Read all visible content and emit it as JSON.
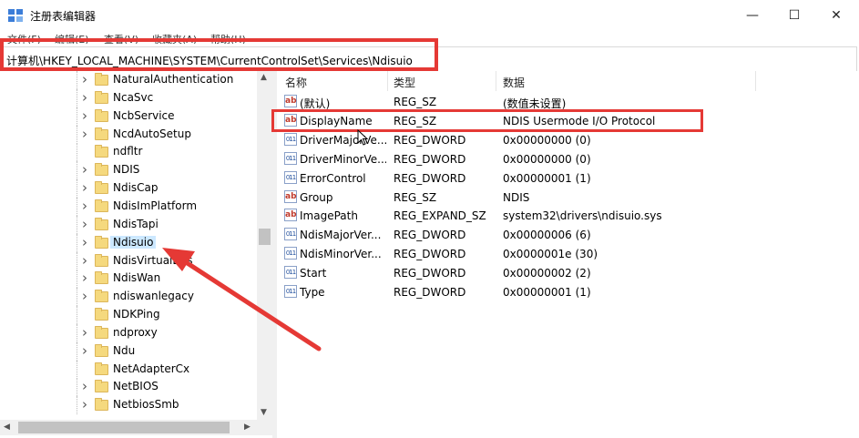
{
  "window": {
    "title": "注册表编辑器",
    "minimize": "—",
    "maximize": "☐",
    "close": "✕"
  },
  "menu": [
    "文件(F)",
    "编辑(E)",
    "查看(V)",
    "收藏夹(A)",
    "帮助(H)"
  ],
  "address": "计算机\\HKEY_LOCAL_MACHINE\\SYSTEM\\CurrentControlSet\\Services\\Ndisuio",
  "tree": {
    "items": [
      {
        "label": "NaturalAuthentication",
        "expandable": true
      },
      {
        "label": "NcaSvc",
        "expandable": true
      },
      {
        "label": "NcbService",
        "expandable": true
      },
      {
        "label": "NcdAutoSetup",
        "expandable": true
      },
      {
        "label": "ndfltr",
        "expandable": false
      },
      {
        "label": "NDIS",
        "expandable": true
      },
      {
        "label": "NdisCap",
        "expandable": true
      },
      {
        "label": "NdisImPlatform",
        "expandable": true
      },
      {
        "label": "NdisTapi",
        "expandable": true
      },
      {
        "label": "Ndisuio",
        "expandable": true,
        "selected": true
      },
      {
        "label": "NdisVirtualBus",
        "expandable": true
      },
      {
        "label": "NdisWan",
        "expandable": true
      },
      {
        "label": "ndiswanlegacy",
        "expandable": true
      },
      {
        "label": "NDKPing",
        "expandable": false
      },
      {
        "label": "ndproxy",
        "expandable": true
      },
      {
        "label": "Ndu",
        "expandable": true
      },
      {
        "label": "NetAdapterCx",
        "expandable": false
      },
      {
        "label": "NetBIOS",
        "expandable": true
      },
      {
        "label": "NetbiosSmb",
        "expandable": true
      }
    ]
  },
  "list": {
    "headers": {
      "name": "名称",
      "type": "类型",
      "data": "数据"
    },
    "rows": [
      {
        "icon": "string-value-icon",
        "name": "(默认)",
        "type": "REG_SZ",
        "data": "(数值未设置)"
      },
      {
        "icon": "string-value-icon",
        "name": "DisplayName",
        "type": "REG_SZ",
        "data": "NDIS Usermode I/O Protocol"
      },
      {
        "icon": "binary-value-icon",
        "name": "DriverMajorVe...",
        "type": "REG_DWORD",
        "data": "0x00000000 (0)"
      },
      {
        "icon": "binary-value-icon",
        "name": "DriverMinorVe...",
        "type": "REG_DWORD",
        "data": "0x00000000 (0)"
      },
      {
        "icon": "binary-value-icon",
        "name": "ErrorControl",
        "type": "REG_DWORD",
        "data": "0x00000001 (1)"
      },
      {
        "icon": "string-value-icon",
        "name": "Group",
        "type": "REG_SZ",
        "data": "NDIS"
      },
      {
        "icon": "string-value-icon",
        "name": "ImagePath",
        "type": "REG_EXPAND_SZ",
        "data": "system32\\drivers\\ndisuio.sys"
      },
      {
        "icon": "binary-value-icon",
        "name": "NdisMajorVer...",
        "type": "REG_DWORD",
        "data": "0x00000006 (6)"
      },
      {
        "icon": "binary-value-icon",
        "name": "NdisMinorVer...",
        "type": "REG_DWORD",
        "data": "0x0000001e (30)"
      },
      {
        "icon": "binary-value-icon",
        "name": "Start",
        "type": "REG_DWORD",
        "data": "0x00000002 (2)"
      },
      {
        "icon": "binary-value-icon",
        "name": "Type",
        "type": "REG_DWORD",
        "data": "0x00000001 (1)"
      }
    ]
  },
  "colors": {
    "highlight": "#e53935",
    "selection": "#cce8ff"
  }
}
